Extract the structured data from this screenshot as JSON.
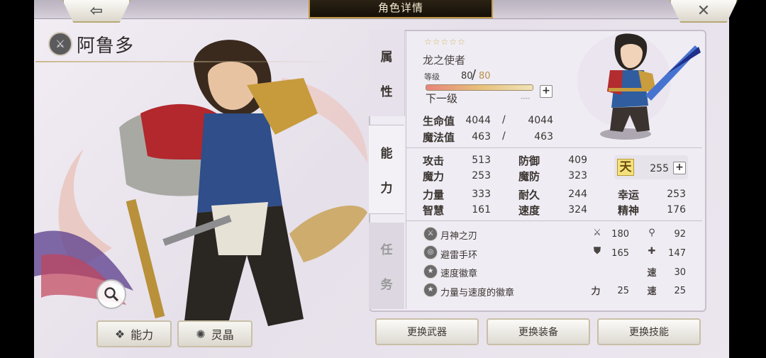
{
  "header": {
    "title": "角色详情",
    "back_icon": "arrow-left-icon",
    "close_icon": "close-icon",
    "back_glyph": "⇦",
    "close_glyph": "✕"
  },
  "character": {
    "name": "阿鲁多",
    "class_icon": "sword-class-icon"
  },
  "tabs": [
    {
      "id": "attr",
      "chars": [
        "属",
        "性"
      ]
    },
    {
      "id": "ability",
      "chars": [
        "能",
        "力"
      ]
    },
    {
      "id": "task",
      "chars": [
        "任",
        "务"
      ]
    }
  ],
  "profile": {
    "stars": "☆☆☆☆☆",
    "title": "龙之使者",
    "level_label": "等级",
    "level_current": "80",
    "level_max": "80",
    "level_progress": 1.0,
    "next_label": "下一级",
    "next_value": "----"
  },
  "vitals": {
    "hp_label": "生命值",
    "hp_current": "4044",
    "hp_max": "4044",
    "mp_label": "魔法值",
    "mp_current": "463",
    "mp_max": "463",
    "slash": "/"
  },
  "stats": {
    "atk_label": "攻击",
    "atk": "513",
    "def_label": "防御",
    "def": "409",
    "mag_label": "魔力",
    "mag": "253",
    "mdef_label": "魔防",
    "mdef": "323",
    "str_label": "力量",
    "str": "333",
    "end_label": "耐久",
    "end": "244",
    "luck_label": "幸运",
    "luck": "253",
    "int_label": "智慧",
    "int": "161",
    "spd_label": "速度",
    "spd": "324",
    "spirit_label": "精神",
    "spirit": "176",
    "heaven_mark": "天",
    "heaven_value": "255"
  },
  "equipment": [
    {
      "name": "月神之刃",
      "icon": "sword-icon",
      "stat1_icon": "sword-icon",
      "stat1": "180",
      "stat2_icon": "magic-wand-icon",
      "stat2": "92"
    },
    {
      "name": "避雷手环",
      "icon": "bracelet-icon",
      "stat1_icon": "shield-icon",
      "stat1": "165",
      "stat2_icon": "cross-shield-icon",
      "stat2": "147"
    },
    {
      "name": "速度徽章",
      "icon": "star-badge-icon",
      "stat2_label": "速",
      "stat2": "30"
    },
    {
      "name": "力量与速度的徽章",
      "icon": "star-badge-icon",
      "stat1_label": "力",
      "stat1": "25",
      "stat2_label": "速",
      "stat2": "25"
    }
  ],
  "buttons": {
    "ability": "能力",
    "crystal": "灵晶",
    "change_weapon": "更换武器",
    "change_equip": "更换装备",
    "change_skill": "更换技能"
  },
  "colors": {
    "accent_gold": "#c49a48",
    "title_bg": "#1e1710",
    "panel_bg": "#f0edf4"
  }
}
